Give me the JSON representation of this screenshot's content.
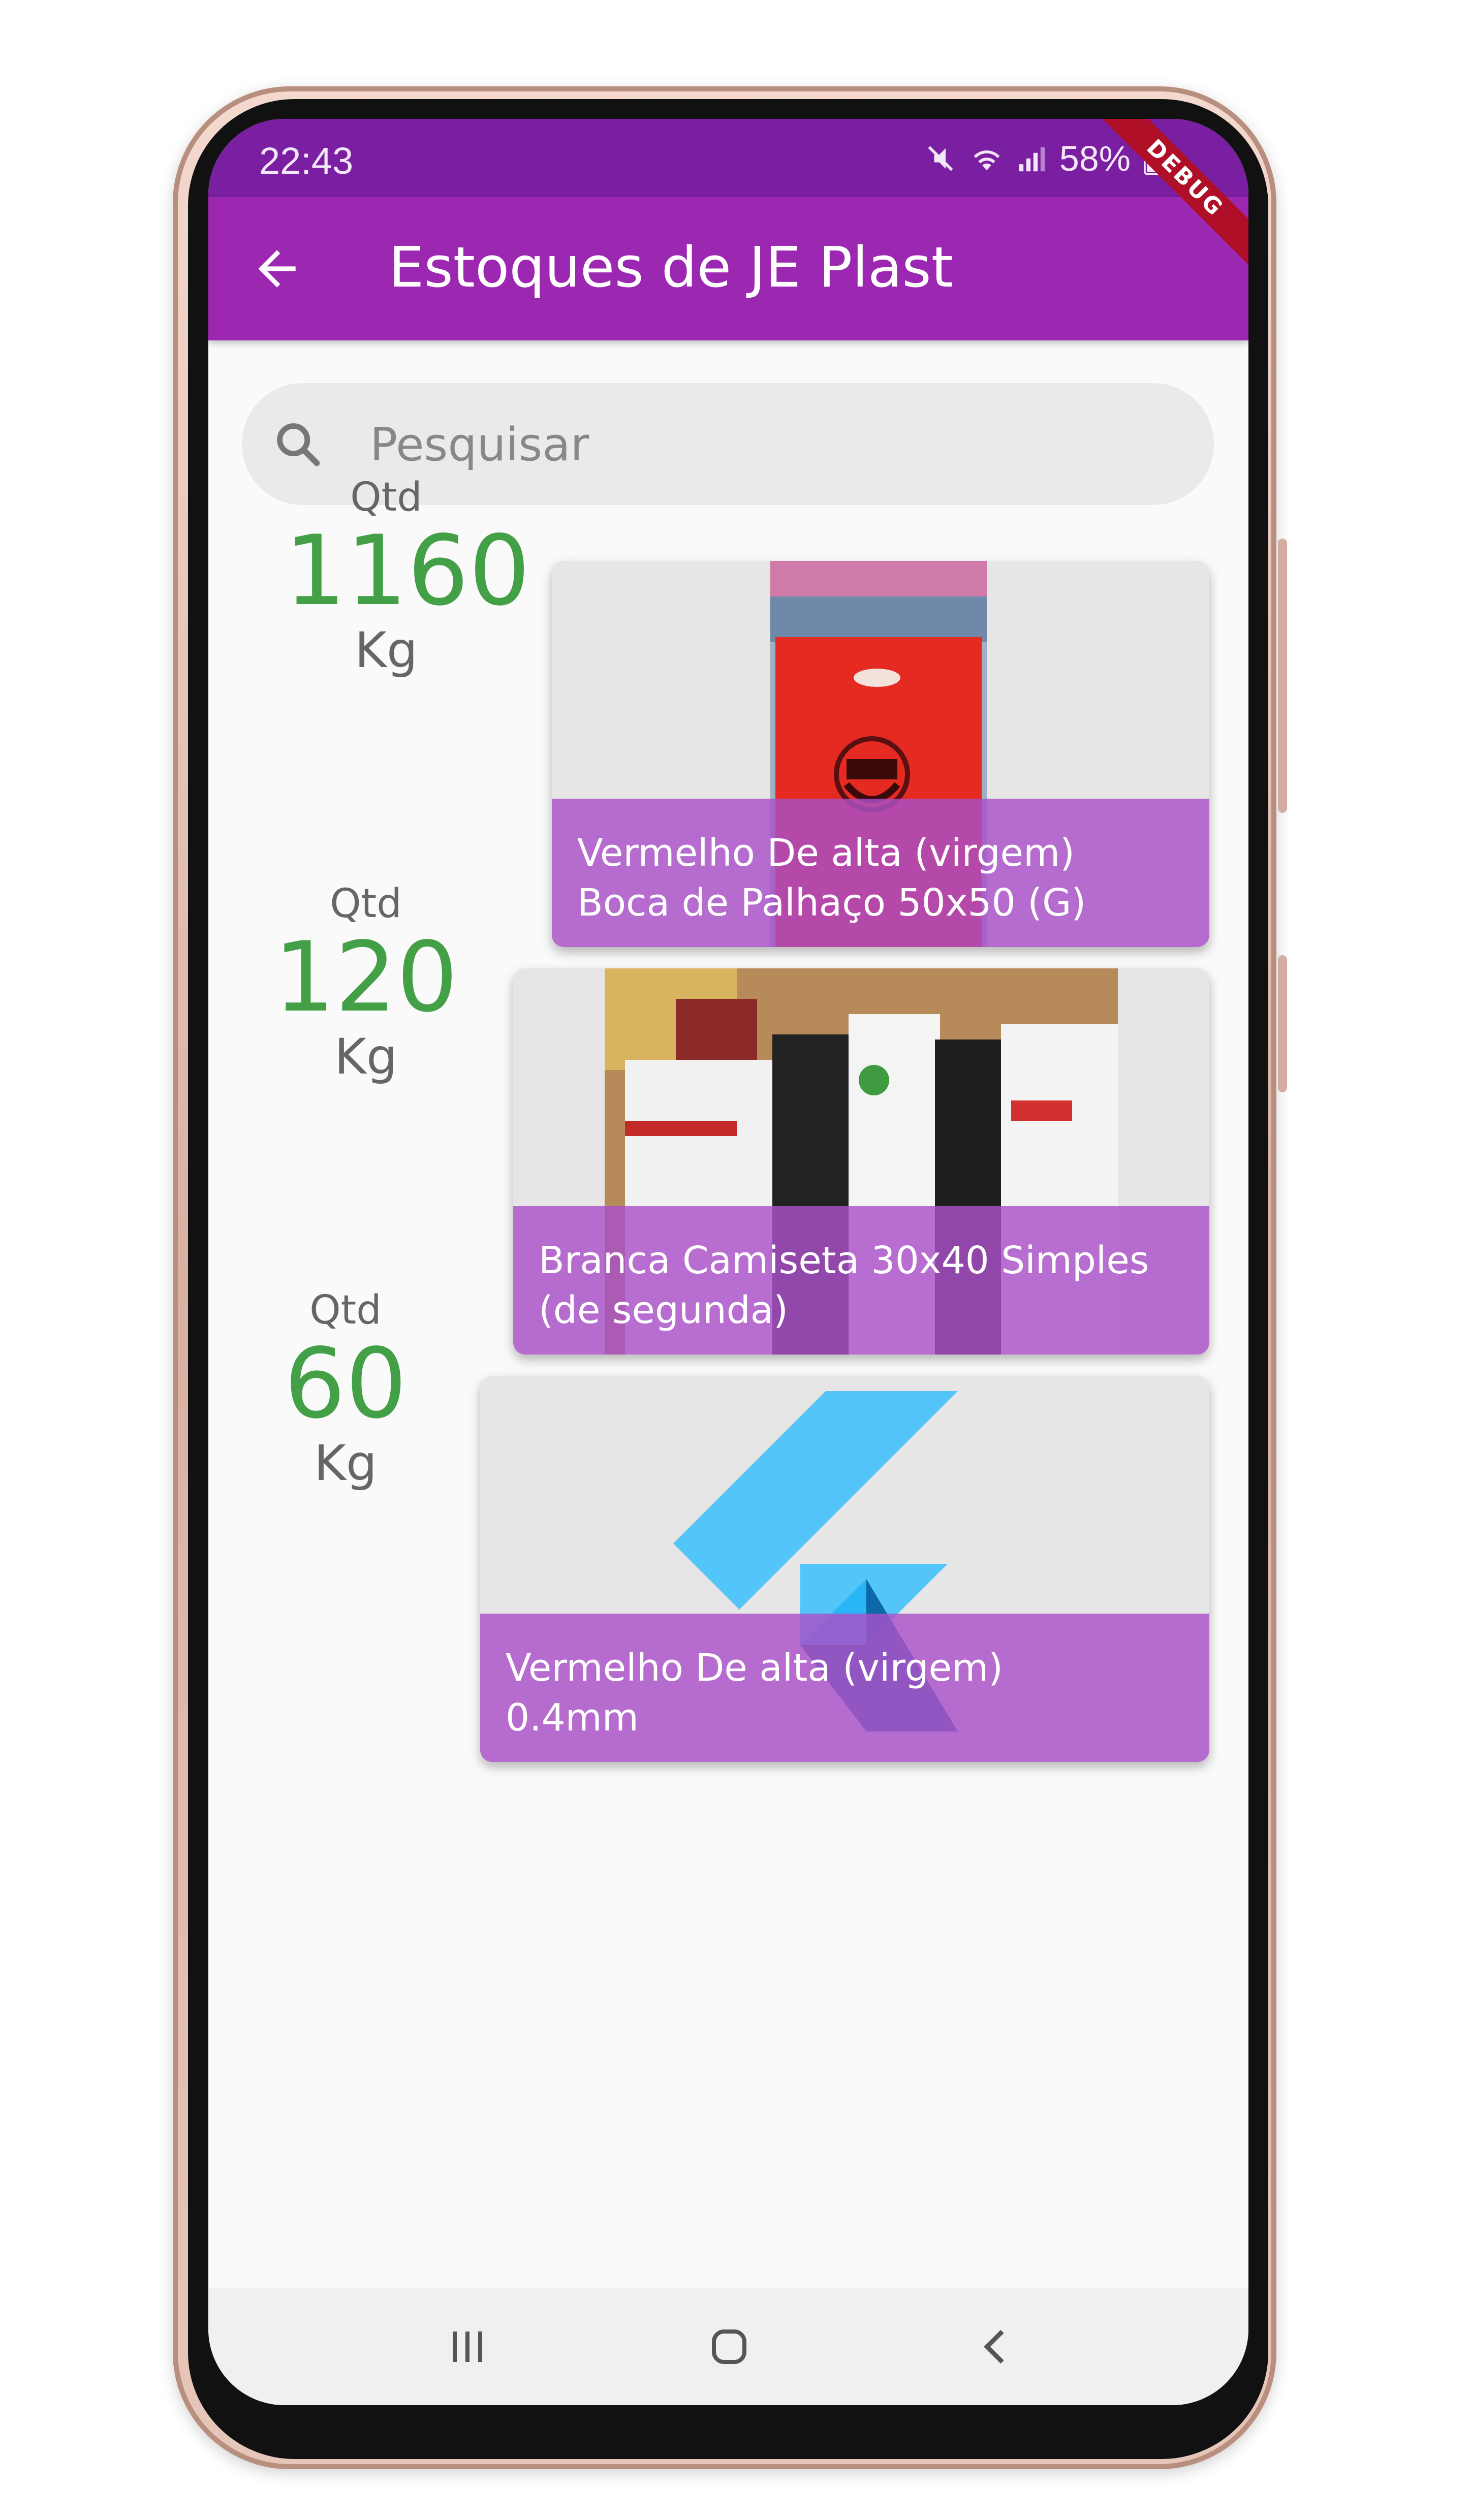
{
  "status_bar": {
    "time": "22:43",
    "battery": "58%",
    "icons": [
      "mute-icon",
      "wifi-icon",
      "signal-icon",
      "battery-icon"
    ]
  },
  "debug_banner": "DEBUG",
  "app_bar": {
    "title": "Estoques de JE Plast",
    "back_icon": "arrow-back-icon",
    "color": "#9c27b0",
    "status_color": "#7b1fa2"
  },
  "search": {
    "placeholder": "Pesquisar",
    "value": "",
    "icon": "search-icon"
  },
  "stock_items": [
    {
      "qty_label": "Qtd",
      "qty_value": "1160",
      "unit": "Kg",
      "name_line1": "Vermelho De alta (virgem)",
      "name_line2": "Boca de Palhaço 50x50 (G)",
      "image": "red-plastic-bag-photo"
    },
    {
      "qty_label": "Qtd",
      "qty_value": "120",
      "unit": "Kg",
      "name_line1": "Branca Camiseta 30x40 Simples",
      "name_line2": "(de segunda)",
      "image": "white-tshirt-bags-photo"
    },
    {
      "qty_label": "Qtd",
      "qty_value": "60",
      "unit": "Kg",
      "name_line1": "Vermelho De alta (virgem)",
      "name_line2": "0.4mm",
      "image": "flutter-logo"
    }
  ],
  "colors": {
    "qty_green": "#43a047",
    "caption_overlay": "#aa50c8"
  },
  "nav_bar": {
    "icons": [
      "recent-apps-icon",
      "home-icon",
      "back-nav-icon"
    ]
  }
}
